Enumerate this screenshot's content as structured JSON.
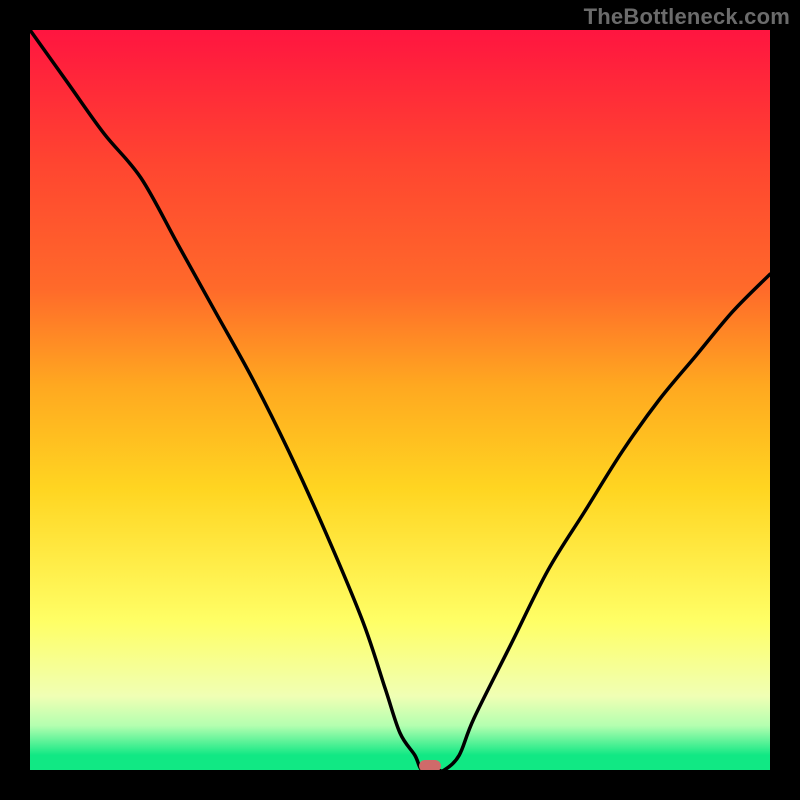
{
  "watermark": "TheBottleneck.com",
  "colors": {
    "top": "#ff1540",
    "mid_upper": "#ff6a2a",
    "mid": "#ffd521",
    "mid_lower": "#ffff66",
    "pale": "#f0ffb4",
    "bottom": "#11e884",
    "marker": "#cf6a6a",
    "curve": "#000000",
    "frame": "#000000"
  },
  "chart_data": {
    "type": "line",
    "title": "",
    "xlabel": "",
    "ylabel": "",
    "xlim": [
      0,
      100
    ],
    "ylim": [
      0,
      100
    ],
    "x": [
      0,
      5,
      10,
      15,
      20,
      25,
      30,
      35,
      40,
      45,
      48,
      50,
      52,
      53,
      55,
      56,
      58,
      60,
      65,
      70,
      75,
      80,
      85,
      90,
      95,
      100
    ],
    "values": [
      100,
      93,
      86,
      80,
      71,
      62,
      53,
      43,
      32,
      20,
      11,
      5,
      2,
      0,
      0,
      0,
      2,
      7,
      17,
      27,
      35,
      43,
      50,
      56,
      62,
      67
    ],
    "min_point": {
      "x": 54,
      "y": 0
    },
    "grid": false,
    "legend": false
  }
}
